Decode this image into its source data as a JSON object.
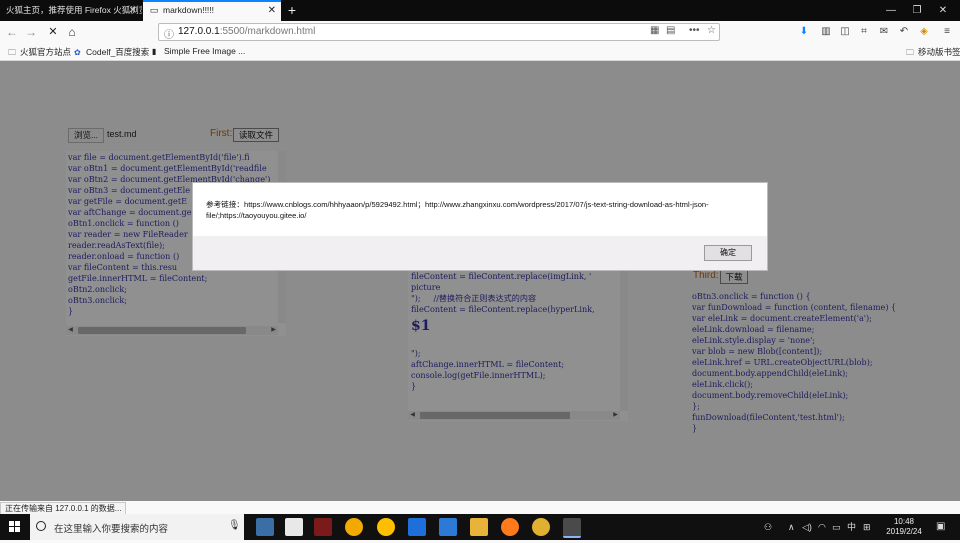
{
  "browser": {
    "tabs": [
      {
        "title": "火狐主页，推荐使用 Firefox 火狐浏览器",
        "active": false
      },
      {
        "title": "markdown!!!!!",
        "active": true
      }
    ],
    "url_host": "127.0.0.1",
    "url_rest": ":5500/markdown.html",
    "bookmarks": [
      "火狐官方站点",
      "Codelf_百度搜索",
      "Simple Free Image ..."
    ],
    "mobile_bookmarks": "移动版书签"
  },
  "page": {
    "file_button": "浏览...",
    "file_name": "test.md",
    "first_label": "First:",
    "read_button": "读取文件",
    "third_label": "Third:",
    "download_button": "下载",
    "left_code": [
      "var file = document.getElementById('file').fi",
      "var oBtn1 = document.getElementById('readfile",
      "var oBtn2 = document.getElementById('change')",
      "var oBtn3 = document.getEle",
      "var getFile = document.getE",
      "var aftChange = document.ge",
      "oBtn1.onclick = function ()",
      "var reader = new FileReader",
      "reader.readAsText(file);",
      "reader.onload = function ()",
      "var fileContent = this.resu",
      "getFile.innerHTML = fileContent;",
      "oBtn2.onclick;",
      "oBtn3.onclick;",
      "}"
    ],
    "middle_code_top": [
      "fileContent = fileContent.replace(imgLink, '",
      "picture",
      "\");     //替换符合正则表达式的内容",
      "fileContent = fileContent.replace(hyperLink,"
    ],
    "middle_heading": "$1",
    "middle_code_bottom": [
      "\");",
      "aftChange.innerHTML = fileContent;",
      "console.log(getFile.innerHTML);",
      "}"
    ],
    "right_code": [
      "oBtn3.onclick = function () {",
      "var funDownload = function (content, filename) {",
      "var eleLink = document.createElement('a');",
      "eleLink.download = filename;",
      "eleLink.style.display = 'none';",
      "var blob = new Blob([content]);",
      "eleLink.href = URL.createObjectURL(blob);",
      "document.body.appendChild(eleLink);",
      "eleLink.click();",
      "document.body.removeChild(eleLink);",
      "};",
      "funDownload(fileContent,'test.html');",
      "}"
    ]
  },
  "dialog": {
    "message": "参考链接：https://www.cnblogs.com/hhhyaaon/p/5929492.html；http://www.zhangxinxu.com/wordpress/2017/07/js-text-string-download-as-html-json-file/;https://taoyouyou.gitee.io/",
    "ok_button": "确定"
  },
  "status": "正在传输来自 127.0.0.1 的数据...",
  "taskbar": {
    "search_placeholder": "在这里输入你要搜索的内容",
    "time": "10:48",
    "date": "2019/2/24",
    "ime": "中"
  },
  "colors": {
    "code_text": "#30309a",
    "label_text": "#b35c00",
    "accent": "#0a84ff"
  }
}
